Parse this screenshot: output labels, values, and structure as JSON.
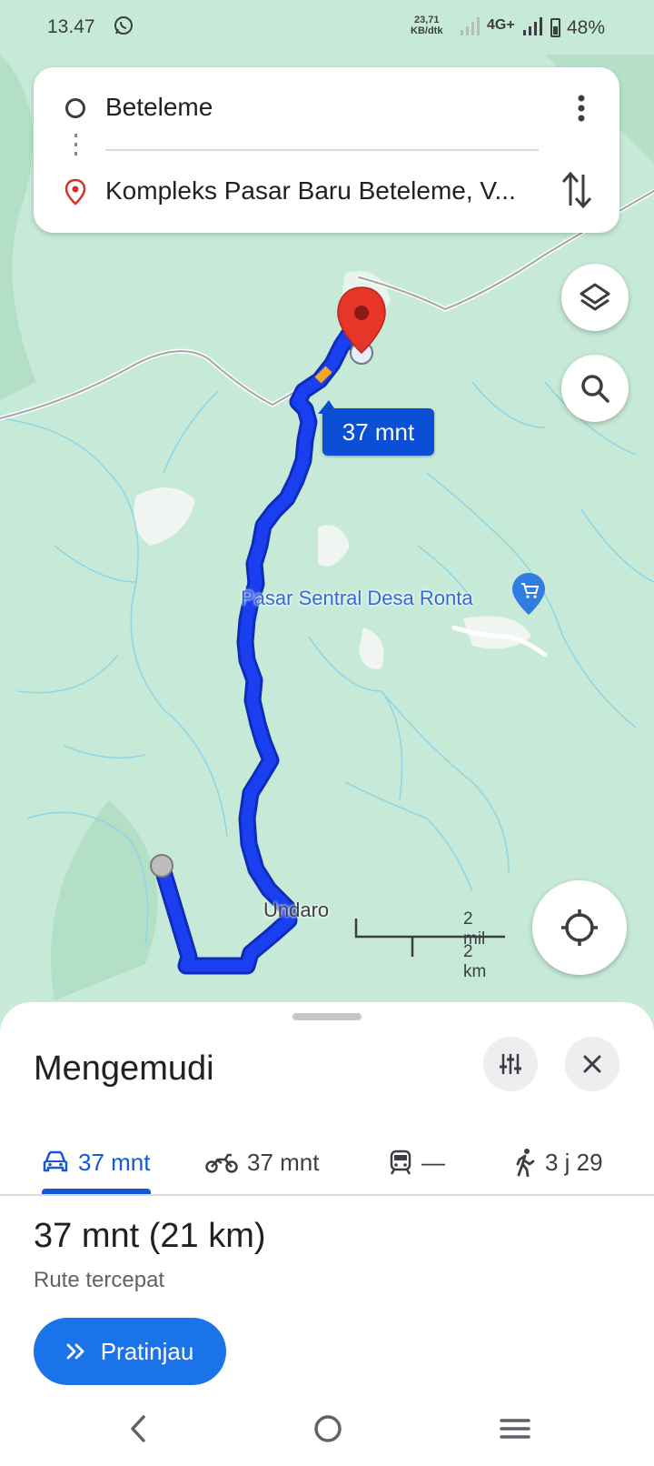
{
  "status_bar": {
    "time": "13.47",
    "speed_value": "23,71",
    "speed_unit": "KB/dtk",
    "network": "4G+",
    "battery": "48%",
    "battery_level": 0.48
  },
  "search": {
    "origin": "Beteleme",
    "destination": "Kompleks Pasar Baru Beteleme, V..."
  },
  "map": {
    "eta_label": "37 mnt",
    "poi_label": "Pasar Sentral Desa Ronta",
    "town_label": "Undaro",
    "scale_mi": "2 mil",
    "scale_km": "2 km",
    "route_color": "#1a3ff0",
    "land_color": "#c6ead7"
  },
  "sheet": {
    "title": "Mengemudi",
    "modes": [
      {
        "icon": "car-icon",
        "label": "37 mnt",
        "active": true
      },
      {
        "icon": "motorcycle-icon",
        "label": "37 mnt",
        "active": false
      },
      {
        "icon": "transit-icon",
        "label": "—",
        "active": false
      },
      {
        "icon": "walk-icon",
        "label": "3 j 29",
        "active": false
      }
    ],
    "route_time": "37 mnt (21 km)",
    "route_desc": "Rute tercepat",
    "preview_label": "Pratinjau"
  },
  "colors": {
    "accent": "#1a73e8",
    "active_mode": "#1558d6",
    "pin": "#d93025"
  }
}
